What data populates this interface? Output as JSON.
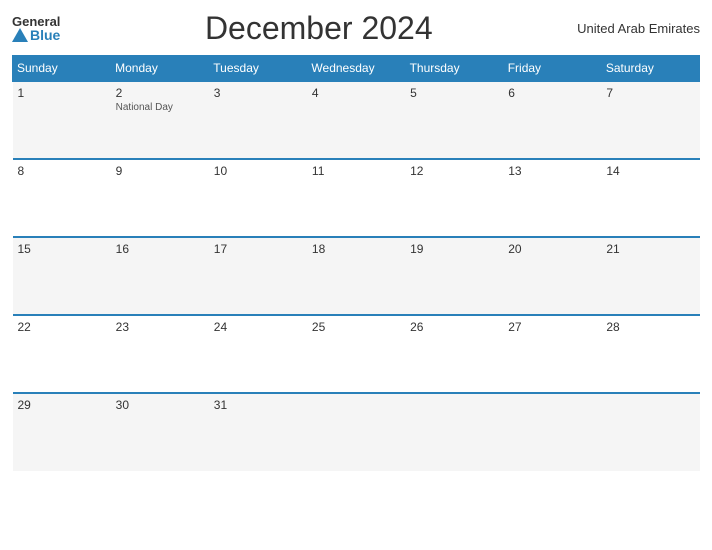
{
  "header": {
    "logo_general": "General",
    "logo_blue": "Blue",
    "title": "December 2024",
    "country": "United Arab Emirates"
  },
  "days_of_week": [
    "Sunday",
    "Monday",
    "Tuesday",
    "Wednesday",
    "Thursday",
    "Friday",
    "Saturday"
  ],
  "weeks": [
    [
      {
        "date": "1",
        "holiday": ""
      },
      {
        "date": "2",
        "holiday": "National Day"
      },
      {
        "date": "3",
        "holiday": ""
      },
      {
        "date": "4",
        "holiday": ""
      },
      {
        "date": "5",
        "holiday": ""
      },
      {
        "date": "6",
        "holiday": ""
      },
      {
        "date": "7",
        "holiday": ""
      }
    ],
    [
      {
        "date": "8",
        "holiday": ""
      },
      {
        "date": "9",
        "holiday": ""
      },
      {
        "date": "10",
        "holiday": ""
      },
      {
        "date": "11",
        "holiday": ""
      },
      {
        "date": "12",
        "holiday": ""
      },
      {
        "date": "13",
        "holiday": ""
      },
      {
        "date": "14",
        "holiday": ""
      }
    ],
    [
      {
        "date": "15",
        "holiday": ""
      },
      {
        "date": "16",
        "holiday": ""
      },
      {
        "date": "17",
        "holiday": ""
      },
      {
        "date": "18",
        "holiday": ""
      },
      {
        "date": "19",
        "holiday": ""
      },
      {
        "date": "20",
        "holiday": ""
      },
      {
        "date": "21",
        "holiday": ""
      }
    ],
    [
      {
        "date": "22",
        "holiday": ""
      },
      {
        "date": "23",
        "holiday": ""
      },
      {
        "date": "24",
        "holiday": ""
      },
      {
        "date": "25",
        "holiday": ""
      },
      {
        "date": "26",
        "holiday": ""
      },
      {
        "date": "27",
        "holiday": ""
      },
      {
        "date": "28",
        "holiday": ""
      }
    ],
    [
      {
        "date": "29",
        "holiday": ""
      },
      {
        "date": "30",
        "holiday": ""
      },
      {
        "date": "31",
        "holiday": ""
      },
      {
        "date": "",
        "holiday": ""
      },
      {
        "date": "",
        "holiday": ""
      },
      {
        "date": "",
        "holiday": ""
      },
      {
        "date": "",
        "holiday": ""
      }
    ]
  ]
}
